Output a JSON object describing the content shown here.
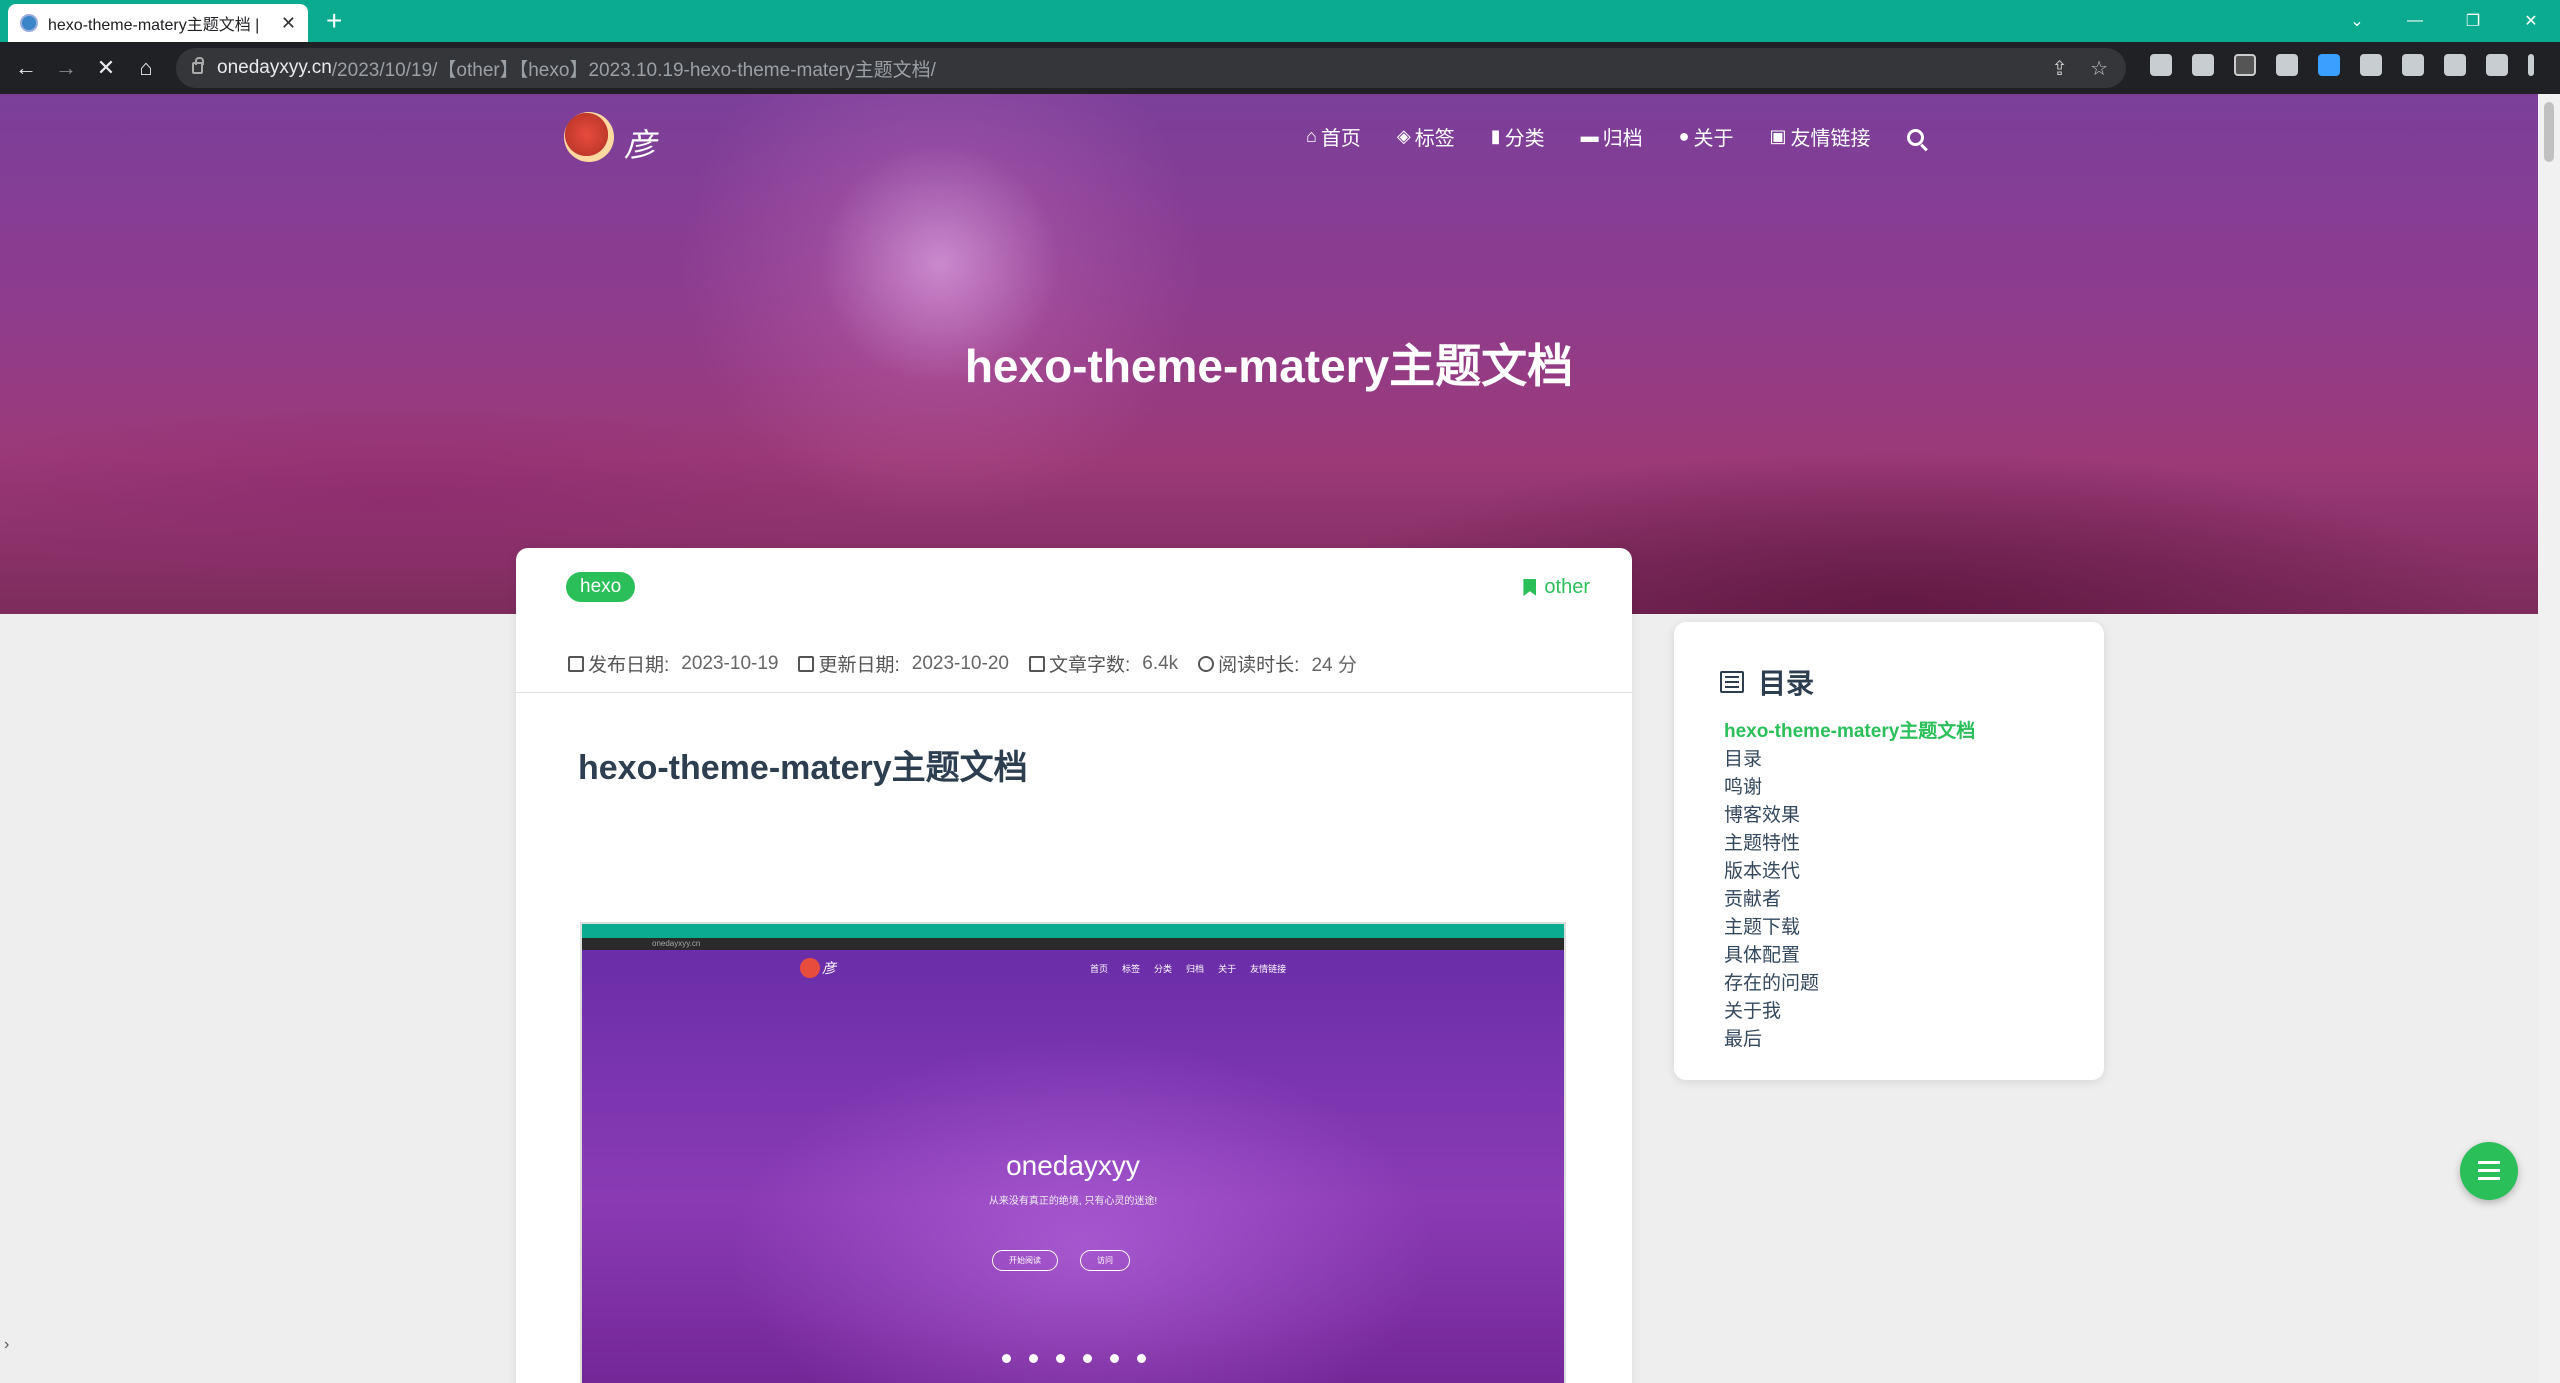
{
  "browser": {
    "tab_title": "hexo-theme-matery主题文档 |",
    "new_tab": "+",
    "url_host": "onedayxyy.cn",
    "url_path": "/2023/10/19/【other】【hexo】2023.10.19-hexo-theme-matery主题文档/",
    "window_controls": [
      "⌄",
      "—",
      "❐",
      "✕"
    ]
  },
  "site": {
    "name": "彦",
    "nav": [
      {
        "icon": "home-icon",
        "glyph": "⌂",
        "label": "首页"
      },
      {
        "icon": "tags-icon",
        "glyph": "◈",
        "label": "标签"
      },
      {
        "icon": "bookmark-icon",
        "glyph": "▮",
        "label": "分类"
      },
      {
        "icon": "archive-icon",
        "glyph": "▬",
        "label": "归档"
      },
      {
        "icon": "user-circle-icon",
        "glyph": "●",
        "label": "关于"
      },
      {
        "icon": "address-book-icon",
        "glyph": "▣",
        "label": "友情链接"
      }
    ]
  },
  "hero": {
    "title": "hexo-theme-matery主题文档"
  },
  "article": {
    "tag": "hexo",
    "category": "other",
    "meta": [
      {
        "label": "发布日期:",
        "value": "2023-10-19"
      },
      {
        "label": "更新日期:",
        "value": "2023-10-20"
      },
      {
        "label": "文章字数:",
        "value": "6.4k"
      },
      {
        "label": "阅读时长:",
        "value": "24 分"
      }
    ],
    "heading": "hexo-theme-matery主题文档"
  },
  "screenshot": {
    "addr": "onedayxyy.cn",
    "site_name": "彦",
    "nav": [
      "首页",
      "标签",
      "分类",
      "归档",
      "关于",
      "友情链接"
    ],
    "title": "onedayxyy",
    "subtitle": "从来没有真正的绝境, 只有心灵的迷途!",
    "btn_start": "开始阅读",
    "btn_visit": "访问"
  },
  "toc": {
    "title": "目录",
    "items": [
      "hexo-theme-matery主题文档",
      "目录",
      "鸣谢",
      "博客效果",
      "主题特性",
      "版本迭代",
      "贡献者",
      "主题下载",
      "具体配置",
      "存在的问题",
      "关于我",
      "最后"
    ],
    "active_index": 0
  },
  "colors": {
    "accent": "#2bbf5a",
    "tabbar": "#0aab8e"
  }
}
